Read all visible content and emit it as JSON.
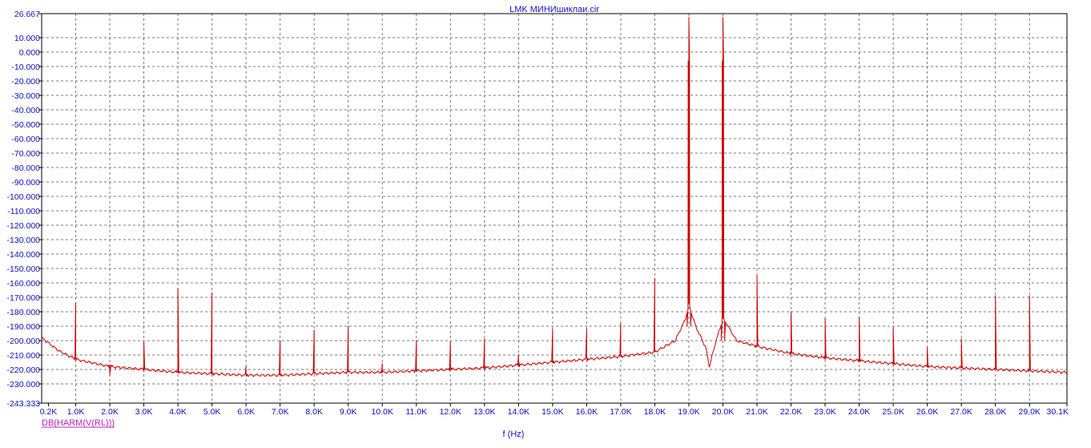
{
  "chart_data": {
    "type": "line",
    "title": "LMK МИНИшиклаи.cir",
    "xlabel": "f (Hz)",
    "ylabel": "",
    "legend": [
      "DB(HARM(V(RL)))"
    ],
    "legend_placement": "bottom-left",
    "grid": true,
    "xlim": [
      0.0,
      30.1
    ],
    "ylim": [
      -243.333,
      26.667
    ],
    "y_ticks": [
      "26.667",
      "10.000",
      "0.000",
      "-10.000",
      "-20.000",
      "-30.000",
      "-40.000",
      "-50.000",
      "-60.000",
      "-70.000",
      "-80.000",
      "-90.000",
      "-100.000",
      "-110.000",
      "-120.000",
      "-130.000",
      "-140.000",
      "-150.000",
      "-160.000",
      "-170.000",
      "-180.000",
      "-190.000",
      "-200.000",
      "-210.000",
      "-220.000",
      "-230.000",
      "-243.333"
    ],
    "y_tick_values": [
      26.667,
      10,
      0,
      -10,
      -20,
      -30,
      -40,
      -50,
      -60,
      -70,
      -80,
      -90,
      -100,
      -110,
      -120,
      -130,
      -140,
      -150,
      -160,
      -170,
      -180,
      -190,
      -200,
      -210,
      -220,
      -230,
      -243.333
    ],
    "x_ticks": [
      "0.2K",
      "1.0K",
      "2.0K",
      "3.0K",
      "4.0K",
      "5.0K",
      "6.0K",
      "7.0K",
      "8.0K",
      "9.0K",
      "10.0K",
      "11.0K",
      "12.0K",
      "13.0K",
      "14.0K",
      "15.0K",
      "16.0K",
      "17.0K",
      "18.0K",
      "19.0K",
      "20.0K",
      "21.0K",
      "22.0K",
      "23.0K",
      "24.0K",
      "25.0K",
      "26.0K",
      "27.0K",
      "28.0K",
      "29.0K",
      "30.1K"
    ],
    "x_tick_values": [
      0.2,
      1,
      2,
      3,
      4,
      5,
      6,
      7,
      8,
      9,
      10,
      11,
      12,
      13,
      14,
      15,
      16,
      17,
      18,
      19,
      20,
      21,
      22,
      23,
      24,
      25,
      26,
      27,
      28,
      29,
      30.1
    ],
    "series": [
      {
        "name": "DB(HARM(V(RL)))",
        "color": "#cc0000",
        "floor": [
          [
            0,
            -198
          ],
          [
            0.5,
            -207
          ],
          [
            1,
            -213
          ],
          [
            2,
            -218
          ],
          [
            3,
            -220
          ],
          [
            4,
            -222
          ],
          [
            5,
            -223
          ],
          [
            6,
            -224
          ],
          [
            7,
            -224
          ],
          [
            8,
            -223
          ],
          [
            9,
            -222
          ],
          [
            10,
            -222
          ],
          [
            11,
            -221
          ],
          [
            12,
            -220
          ],
          [
            13,
            -219
          ],
          [
            14,
            -217
          ],
          [
            15,
            -215
          ],
          [
            16,
            -213
          ],
          [
            17,
            -211
          ],
          [
            18,
            -208
          ],
          [
            18.6,
            -200
          ],
          [
            18.9,
            -185
          ],
          [
            19.0,
            -175
          ],
          [
            19.2,
            -190
          ],
          [
            19.5,
            -205
          ],
          [
            19.6,
            -218
          ],
          [
            19.8,
            -200
          ],
          [
            20.0,
            -185
          ],
          [
            20.1,
            -188
          ],
          [
            20.4,
            -200
          ],
          [
            21,
            -204
          ],
          [
            22,
            -209
          ],
          [
            23,
            -212
          ],
          [
            24,
            -214
          ],
          [
            25,
            -216
          ],
          [
            26,
            -218
          ],
          [
            27,
            -219
          ],
          [
            28,
            -220
          ],
          [
            29,
            -221
          ],
          [
            30.1,
            -222
          ]
        ],
        "peaks": [
          {
            "x": 1,
            "y": -174
          },
          {
            "x": 2,
            "y": -224
          },
          {
            "x": 3,
            "y": -201
          },
          {
            "x": 4,
            "y": -164
          },
          {
            "x": 5,
            "y": -167
          },
          {
            "x": 6,
            "y": -218
          },
          {
            "x": 7,
            "y": -200
          },
          {
            "x": 8,
            "y": -193
          },
          {
            "x": 9,
            "y": -190
          },
          {
            "x": 10,
            "y": -216
          },
          {
            "x": 11,
            "y": -200
          },
          {
            "x": 12,
            "y": -201
          },
          {
            "x": 13,
            "y": -199
          },
          {
            "x": 14,
            "y": -210
          },
          {
            "x": 15,
            "y": -192
          },
          {
            "x": 16,
            "y": -192
          },
          {
            "x": 17,
            "y": -188
          },
          {
            "x": 18,
            "y": -157
          },
          {
            "x": 19,
            "y": 24
          },
          {
            "x": 20,
            "y": 24
          },
          {
            "x": 21,
            "y": -155
          },
          {
            "x": 22,
            "y": -180
          },
          {
            "x": 23,
            "y": -185
          },
          {
            "x": 24,
            "y": -184
          },
          {
            "x": 25,
            "y": -191
          },
          {
            "x": 26,
            "y": -205
          },
          {
            "x": 27,
            "y": -199
          },
          {
            "x": 28,
            "y": -169
          },
          {
            "x": 29,
            "y": -169
          }
        ]
      }
    ]
  }
}
